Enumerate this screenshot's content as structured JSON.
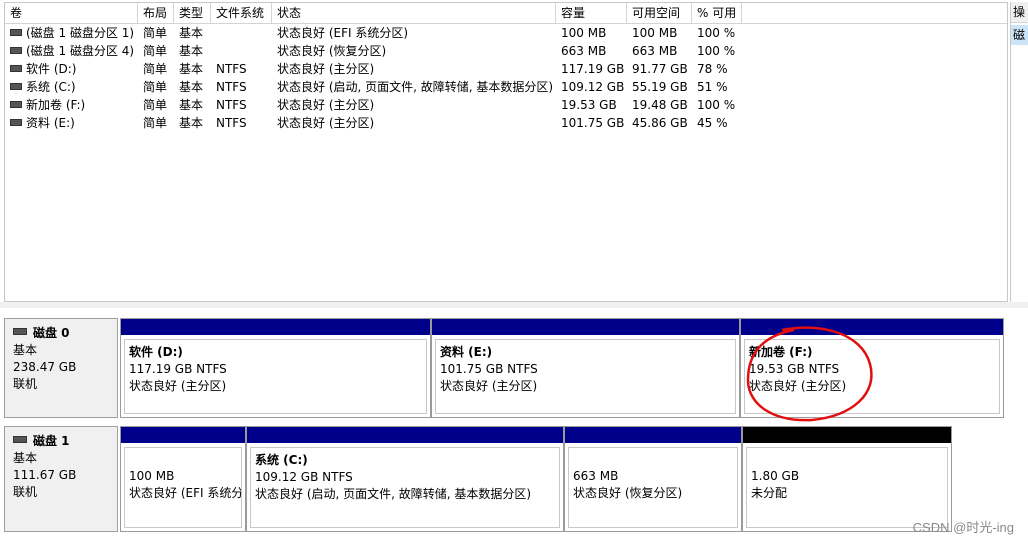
{
  "table": {
    "headers": [
      "卷",
      "布局",
      "类型",
      "文件系统",
      "状态",
      "容量",
      "可用空间",
      "% 可用"
    ],
    "rows": [
      [
        "(磁盘 1 磁盘分区 1)",
        "简单",
        "基本",
        "",
        "状态良好 (EFI 系统分区)",
        "100 MB",
        "100 MB",
        "100 %"
      ],
      [
        "(磁盘 1 磁盘分区 4)",
        "简单",
        "基本",
        "",
        "状态良好 (恢复分区)",
        "663 MB",
        "663 MB",
        "100 %"
      ],
      [
        "软件 (D:)",
        "简单",
        "基本",
        "NTFS",
        "状态良好 (主分区)",
        "117.19 GB",
        "91.77 GB",
        "78 %"
      ],
      [
        "系统 (C:)",
        "简单",
        "基本",
        "NTFS",
        "状态良好 (启动, 页面文件, 故障转储, 基本数据分区)",
        "109.12 GB",
        "55.19 GB",
        "51 %"
      ],
      [
        "新加卷 (F:)",
        "简单",
        "基本",
        "NTFS",
        "状态良好 (主分区)",
        "19.53 GB",
        "19.48 GB",
        "100 %"
      ],
      [
        "资料 (E:)",
        "简单",
        "基本",
        "NTFS",
        "状态良好 (主分区)",
        "101.75 GB",
        "45.86 GB",
        "45 %"
      ]
    ]
  },
  "actions": {
    "header": "操",
    "item": "磁"
  },
  "disks": [
    {
      "name": "磁盘 0",
      "type": "基本",
      "size": "238.47 GB",
      "status": "联机",
      "partitions": [
        {
          "name": "软件 (D:)",
          "size": "117.19 GB NTFS",
          "status": "状态良好 (主分区)"
        },
        {
          "name": "资料 (E:)",
          "size": "101.75 GB NTFS",
          "status": "状态良好 (主分区)"
        },
        {
          "name": "新加卷 (F:)",
          "size": "19.53 GB NTFS",
          "status": "状态良好 (主分区)"
        }
      ]
    },
    {
      "name": "磁盘 1",
      "type": "基本",
      "size": "111.67 GB",
      "status": "联机",
      "partitions": [
        {
          "name": "",
          "size": "100 MB",
          "status": "状态良好 (EFI 系统分"
        },
        {
          "name": "系统 (C:)",
          "size": "109.12 GB NTFS",
          "status": "状态良好 (启动, 页面文件, 故障转储, 基本数据分区)"
        },
        {
          "name": "",
          "size": "663 MB",
          "status": "状态良好 (恢复分区)"
        },
        {
          "name": "",
          "size": "1.80 GB",
          "status": "未分配"
        }
      ]
    }
  ],
  "watermark": "CSDN @时光-ing",
  "colors": {
    "primary_partition_bar": "#00008b",
    "unallocated_bar": "#000000",
    "annotation": "#e01010"
  }
}
